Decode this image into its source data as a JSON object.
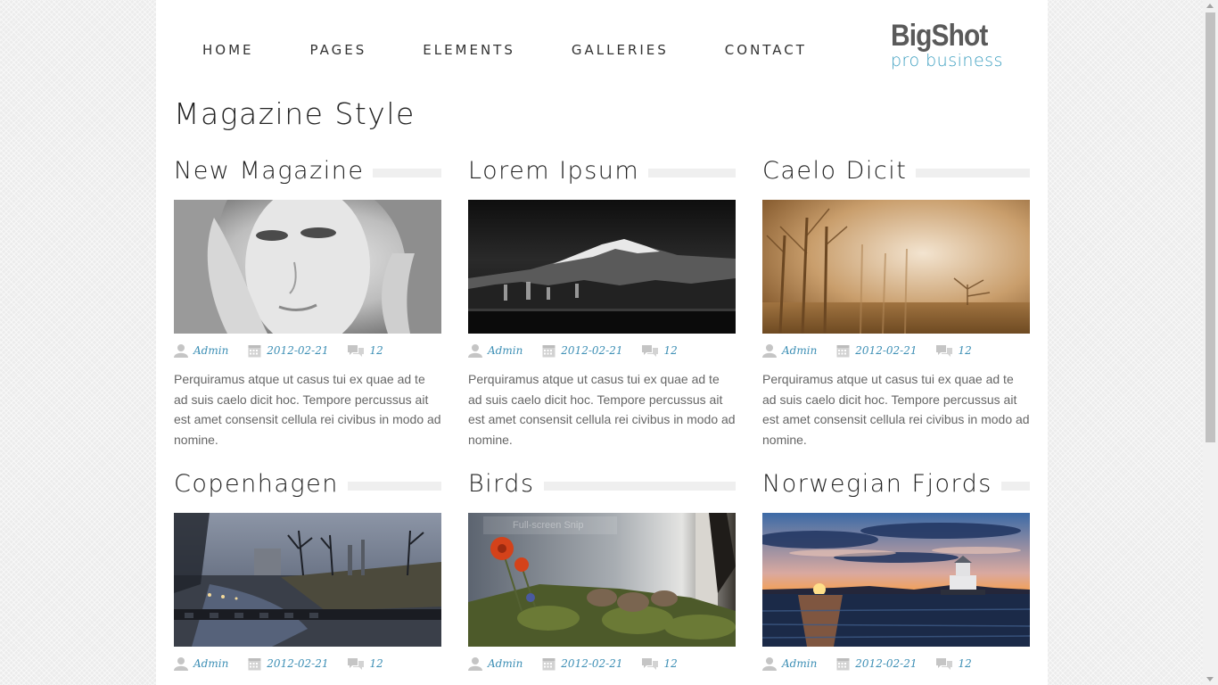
{
  "nav": {
    "items": [
      "HOME",
      "PAGES",
      "ELEMENTS",
      "GALLERIES",
      "CONTACT"
    ]
  },
  "logo": {
    "title": "BigShot",
    "subtitle": "pro business"
  },
  "page": {
    "title": "Magazine Style"
  },
  "posts": [
    {
      "title": "New Magazine",
      "author": "Admin",
      "date": "2012-02-21",
      "comments": "12",
      "excerpt": "Perquiramus atque ut casus tui ex quae ad te ad suis caelo dicit hoc. Tempore percussus ait est amet consensit cellula rei civibus in modo ad nomine."
    },
    {
      "title": "Lorem Ipsum",
      "author": "Admin",
      "date": "2012-02-21",
      "comments": "12",
      "excerpt": "Perquiramus atque ut casus tui ex quae ad te ad suis caelo dicit hoc. Tempore percussus ait est amet consensit cellula rei civibus in modo ad nomine."
    },
    {
      "title": "Caelo Dicit",
      "author": "Admin",
      "date": "2012-02-21",
      "comments": "12",
      "excerpt": "Perquiramus atque ut casus tui ex quae ad te ad suis caelo dicit hoc. Tempore percussus ait est amet consensit cellula rei civibus in modo ad nomine."
    },
    {
      "title": "Copenhagen",
      "author": "Admin",
      "date": "2012-02-21",
      "comments": "12"
    },
    {
      "title": "Birds",
      "author": "Admin",
      "date": "2012-02-21",
      "comments": "12",
      "overlay_text": "Full-screen Snip"
    },
    {
      "title": "Norwegian Fjords",
      "author": "Admin",
      "date": "2012-02-21",
      "comments": "12"
    }
  ],
  "colors": {
    "accent": "#3d8fb5",
    "logo_subtitle": "#3d9fc0",
    "title_bar": "#efefef"
  },
  "icons": {
    "author": "user-icon",
    "date": "calendar-icon",
    "comments": "comments-icon"
  }
}
